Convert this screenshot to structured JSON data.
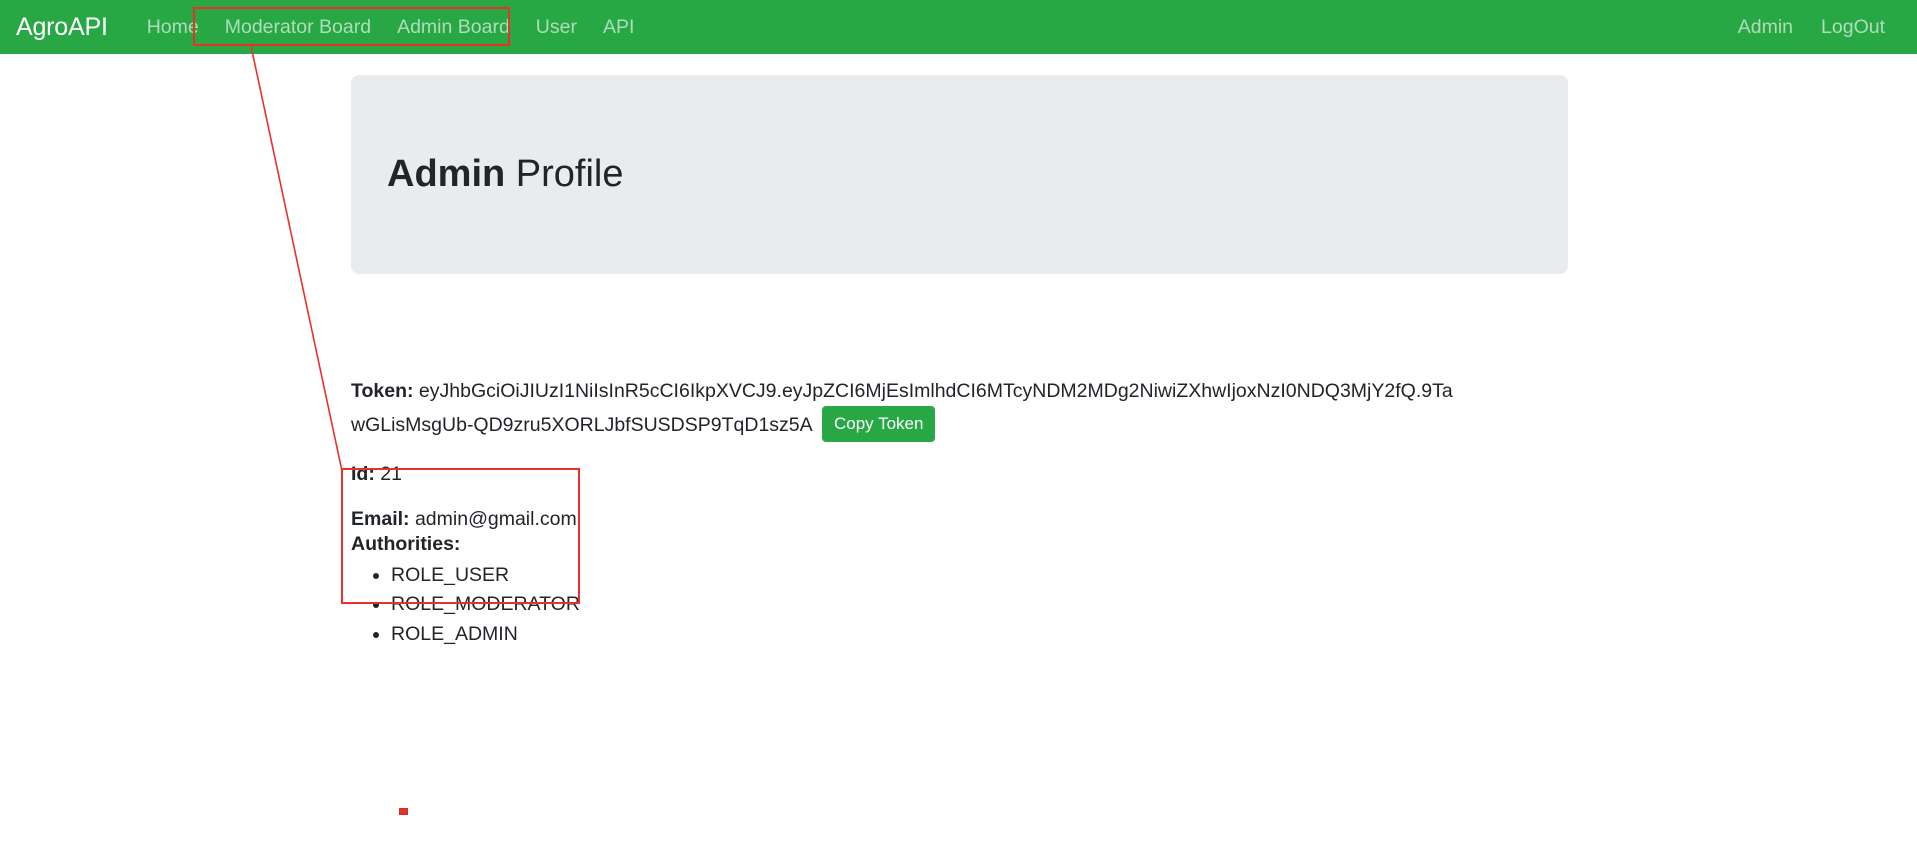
{
  "navbar": {
    "brand": "AgroAPI",
    "brand_color": "#ffffff",
    "background_color": "#28a745",
    "left_links": [
      {
        "label": "Home",
        "name": "nav-link-home"
      },
      {
        "label": "Moderator Board",
        "name": "nav-link-moderator-board"
      },
      {
        "label": "Admin Board",
        "name": "nav-link-admin-board"
      },
      {
        "label": "User",
        "name": "nav-link-user"
      },
      {
        "label": "API",
        "name": "nav-link-api"
      }
    ],
    "right_links": [
      {
        "label": "Admin",
        "name": "nav-link-admin-username"
      },
      {
        "label": "LogOut",
        "name": "nav-link-logout"
      }
    ]
  },
  "header": {
    "title_bold": "Admin",
    "title_rest": " Profile",
    "background_color": "#e9ecef"
  },
  "profile": {
    "token_label": "Token:",
    "token_value": "eyJhbGciOiJIUzI1NiIsInR5cCI6IkpXVCJ9.eyJpZCI6MjEsImlhdCI6MTcyNDM2MDg2NiwiZXhwIjoxNzI0NDQ3MjY2fQ.9TawGLisMsgUb-QD9zru5XORLJbfSUSDSP9TqD1sz5A",
    "copy_token_label": "Copy Token",
    "copy_token_color": "#28a745",
    "id_label": "Id:",
    "id_value": "21",
    "email_label": "Email:",
    "email_value": "admin@gmail.com",
    "authorities_label": "Authorities:",
    "authorities": [
      "ROLE_USER",
      "ROLE_MODERATOR",
      "ROLE_ADMIN"
    ]
  },
  "annotations": {
    "color": "#e8312a",
    "nav_highlight_target": "Moderator Board / Admin Board / User",
    "authorities_highlight_target": "Authorities list"
  }
}
